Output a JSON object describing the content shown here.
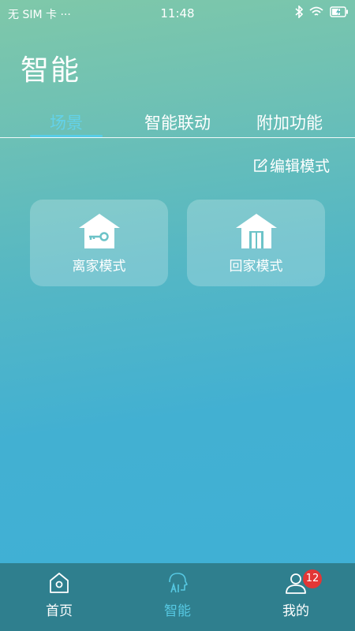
{
  "status_bar": {
    "carrier": "无 SIM 卡 ···",
    "time": "11:48",
    "icons": [
      "bluetooth-icon",
      "wifi-icon",
      "battery-charging-icon"
    ]
  },
  "page": {
    "title": "智能"
  },
  "tabs": [
    {
      "label": "场景",
      "active": true
    },
    {
      "label": "智能联动",
      "active": false
    },
    {
      "label": "附加功能",
      "active": false
    }
  ],
  "edit_mode": {
    "icon": "edit-icon",
    "label": "编辑模式"
  },
  "scenes": [
    {
      "label": "离家模式",
      "icon": "house-key-icon"
    },
    {
      "label": "回家模式",
      "icon": "house-door-icon"
    }
  ],
  "bottom_nav": {
    "items": [
      {
        "label": "首页",
        "icon": "home-icon",
        "active": false
      },
      {
        "label": "智能",
        "icon": "ai-icon",
        "active": true
      },
      {
        "label": "我的",
        "icon": "user-icon",
        "active": false,
        "badge": "12"
      }
    ]
  },
  "colors": {
    "accent": "#57cde6",
    "nav_background": "#2f7f8e",
    "badge": "#e23636"
  }
}
